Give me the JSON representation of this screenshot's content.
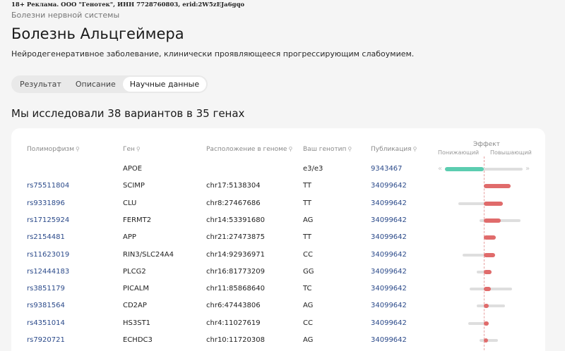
{
  "ad": "18+ Реклама. ООО \"Генотек\", ИНН 7728760803, erid:2W5zEJa6gqo",
  "breadcrumb": "Болезни нервной системы",
  "title": "Болезнь Альцгеймера",
  "description": "Нейродегенеративное заболевание, клинически проявляющееся прогрессирующим слабоумием.",
  "tabs": [
    "Результат",
    "Описание",
    "Научные данные"
  ],
  "active_tab": "Научные данные",
  "heading": "Мы исследовали 38 вариантов в 35 генах",
  "table": {
    "columns": [
      "Полиморфизм",
      "Ген",
      "Расположение в геноме",
      "Ваш генотип",
      "Публикация"
    ],
    "effect": {
      "title": "Эффект",
      "low": "Понижающий",
      "high": "Повышающий"
    },
    "rows": [
      {
        "rs": "",
        "gene": "APOE",
        "loc": "",
        "gt": "e3/e3",
        "pub": "9343467",
        "effect": -0.55,
        "range": [
          -0.55,
          0.55
        ],
        "color": "#5ccdb0"
      },
      {
        "rs": "rs75511804",
        "gene": "SCIMP",
        "loc": "chr17:5138304",
        "gt": "TT",
        "pub": "34099642",
        "effect": 0.38,
        "range": [
          0,
          0.38
        ],
        "color": "#e06b6b"
      },
      {
        "rs": "rs9331896",
        "gene": "CLU",
        "loc": "chr8:27467686",
        "gt": "TT",
        "pub": "34099642",
        "effect": 0.27,
        "range": [
          -0.36,
          0.27
        ],
        "color": "#e06b6b"
      },
      {
        "rs": "rs17125924",
        "gene": "FERMT2",
        "loc": "chr14:53391680",
        "gt": "AG",
        "pub": "34099642",
        "effect": 0.24,
        "range": [
          -0.06,
          0.52
        ],
        "color": "#e06b6b"
      },
      {
        "rs": "rs2154481",
        "gene": "APP",
        "loc": "chr21:27473875",
        "gt": "TT",
        "pub": "34099642",
        "effect": 0.17,
        "range": [
          0,
          0.17
        ],
        "color": "#e06b6b"
      },
      {
        "rs": "rs11623019",
        "gene": "RIN3/SLC24A4",
        "loc": "chr14:92936971",
        "gt": "CC",
        "pub": "34099642",
        "effect": 0.16,
        "range": [
          -0.3,
          0.16
        ],
        "color": "#e06b6b"
      },
      {
        "rs": "rs12444183",
        "gene": "PLCG2",
        "loc": "chr16:81773209",
        "gt": "GG",
        "pub": "34099642",
        "effect": 0.11,
        "range": [
          -0.1,
          0.11
        ],
        "color": "#e06b6b"
      },
      {
        "rs": "rs3851179",
        "gene": "PICALM",
        "loc": "chr11:85868640",
        "gt": "TC",
        "pub": "34099642",
        "effect": 0.1,
        "range": [
          -0.2,
          0.4
        ],
        "color": "#e06b6b"
      },
      {
        "rs": "rs9381564",
        "gene": "CD2AP",
        "loc": "chr6:47443806",
        "gt": "AG",
        "pub": "34099642",
        "effect": 0.07,
        "range": [
          -0.1,
          0.3
        ],
        "color": "#e06b6b"
      },
      {
        "rs": "rs4351014",
        "gene": "HS3ST1",
        "loc": "chr4:11027619",
        "gt": "CC",
        "pub": "34099642",
        "effect": 0.07,
        "range": [
          -0.22,
          0.07
        ],
        "color": "#e06b6b"
      },
      {
        "rs": "rs7920721",
        "gene": "ECHDC3",
        "loc": "chr10:11720308",
        "gt": "AG",
        "pub": "34099642",
        "effect": 0.06,
        "range": [
          -0.06,
          0.2
        ],
        "color": "#e06b6b"
      }
    ]
  },
  "icons": {
    "search": "search-icon",
    "left": "chevron-left-icon",
    "right": "chevron-right-icon"
  }
}
